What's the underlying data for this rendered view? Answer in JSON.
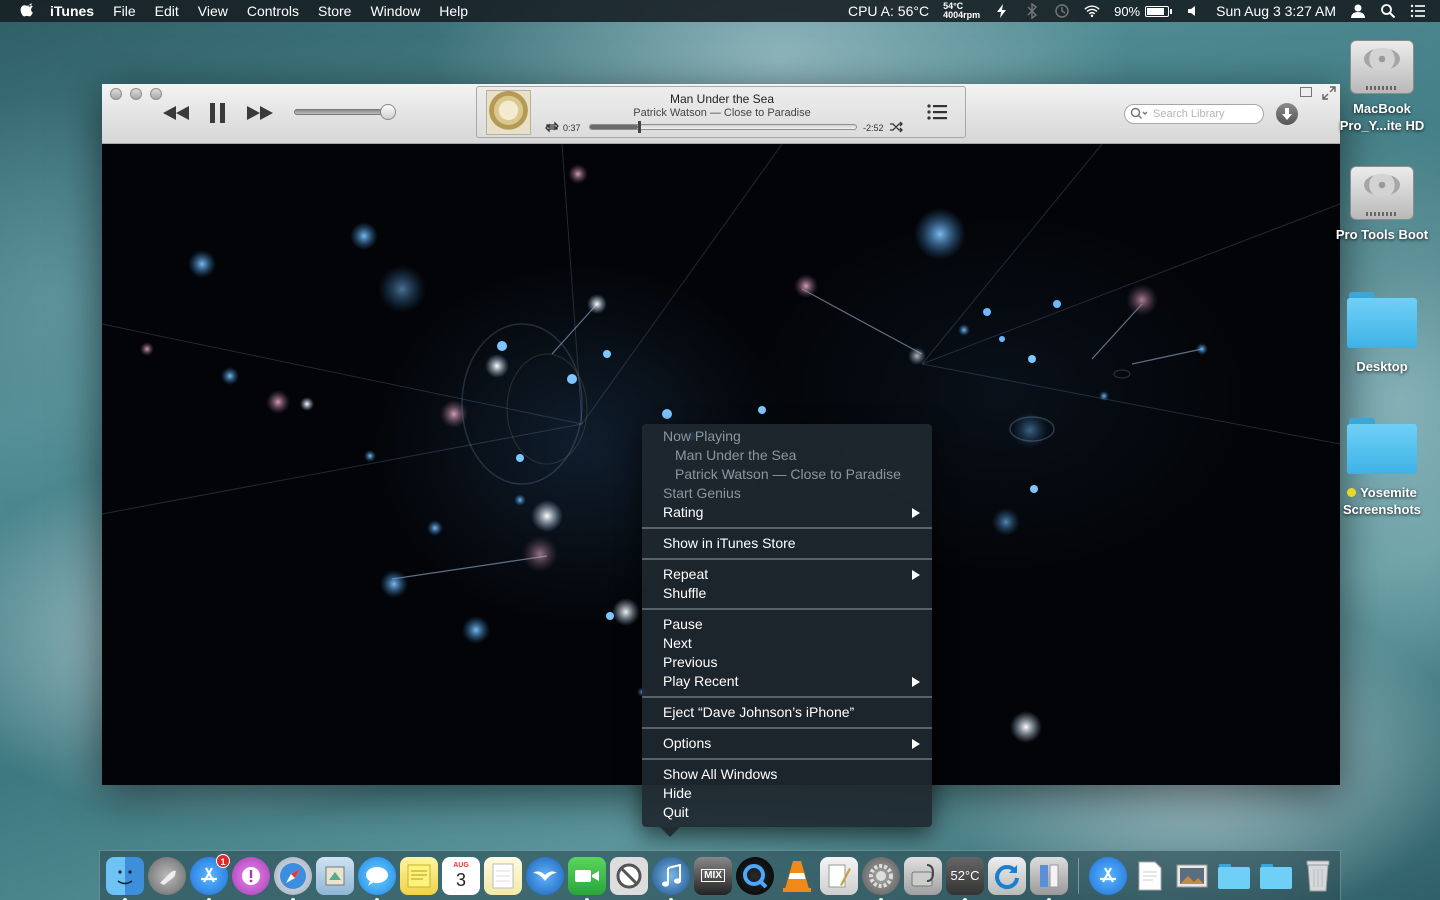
{
  "menubar": {
    "app_name": "iTunes",
    "items": [
      "File",
      "Edit",
      "View",
      "Controls",
      "Store",
      "Window",
      "Help"
    ],
    "cpu": "CPU A: 56°C",
    "temp_top": "54°C",
    "temp_bottom": "4004rpm",
    "battery": "90%",
    "battery_level": 0.9,
    "datetime": "Sun Aug 3  3:27 AM"
  },
  "player": {
    "song": "Man Under the Sea",
    "artist_album": "Patrick Watson — Close to Paradise",
    "elapsed": "0:37",
    "remaining": "-2:52",
    "progress": 0.18,
    "volume": 1.0,
    "search_placeholder": "Search Library"
  },
  "context_menu": {
    "now_playing": "Now Playing",
    "np_song": "Man Under the Sea",
    "np_artist": "Patrick Watson — Close to Paradise",
    "start_genius": "Start Genius",
    "rating": "Rating",
    "show_store": "Show in iTunes Store",
    "repeat": "Repeat",
    "shuffle": "Shuffle",
    "pause": "Pause",
    "next": "Next",
    "previous": "Previous",
    "play_recent": "Play Recent",
    "eject": "Eject “Dave Johnson’s iPhone”",
    "options": "Options",
    "show_all": "Show All Windows",
    "hide": "Hide",
    "quit": "Quit"
  },
  "desktop": {
    "hdd1_line1": "MacBook",
    "hdd1_line2": "Pro_Y...ite HD",
    "hdd2": "Pro Tools Boot",
    "folder1": "Desktop",
    "folder2_line1": "Yosemite",
    "folder2_line2": "Screenshots",
    "tag_color": "#e9d92c"
  },
  "dock": {
    "app_store_badge": "1",
    "calendar_month": "AUG",
    "calendar_day": "3",
    "temp_widget": "52°C",
    "mix_label": "MIX",
    "accent": "#3aa7d8"
  }
}
